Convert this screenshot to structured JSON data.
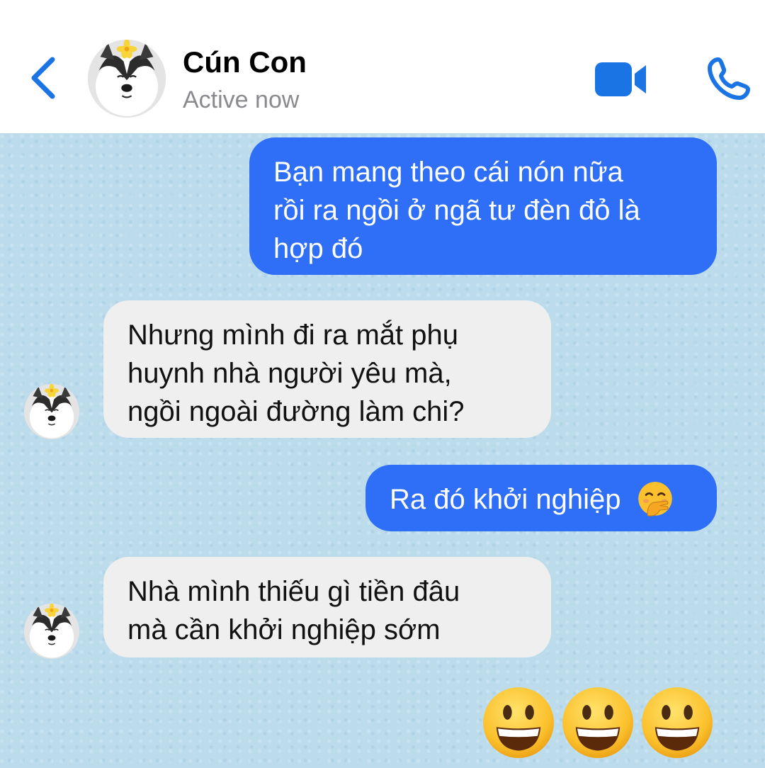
{
  "header": {
    "contact_name": "Cún Con",
    "status": "Active now",
    "accent_color": "#1b74e4",
    "icons": [
      "chevron-left-icon",
      "video-camera-icon",
      "phone-icon"
    ]
  },
  "messages": [
    {
      "from": "me",
      "lines": [
        "Bạn mang theo cái nón nữa",
        "rồi ra ngồi ở ngã tư đèn đỏ là",
        "hợp đó"
      ]
    },
    {
      "from": "contact",
      "lines": [
        "Nhưng mình đi ra mắt phụ",
        "huynh nhà người yêu mà,",
        "ngồi ngoài đường làm chi?"
      ]
    },
    {
      "from": "me",
      "lines": [
        "Ra đó khởi nghiệp"
      ],
      "emoji": "hand-over-mouth-emoji"
    },
    {
      "from": "contact",
      "lines": [
        "Nhà mình thiếu gì tiền đâu",
        "mà cần khởi nghiệp sớm"
      ]
    }
  ],
  "reaction": {
    "emoji": "grinning-face-emoji",
    "count": 3
  },
  "colors": {
    "outgoing_bubble": "#2f6ff7",
    "incoming_bubble": "#efefef",
    "chat_background": "#bcdcec"
  }
}
